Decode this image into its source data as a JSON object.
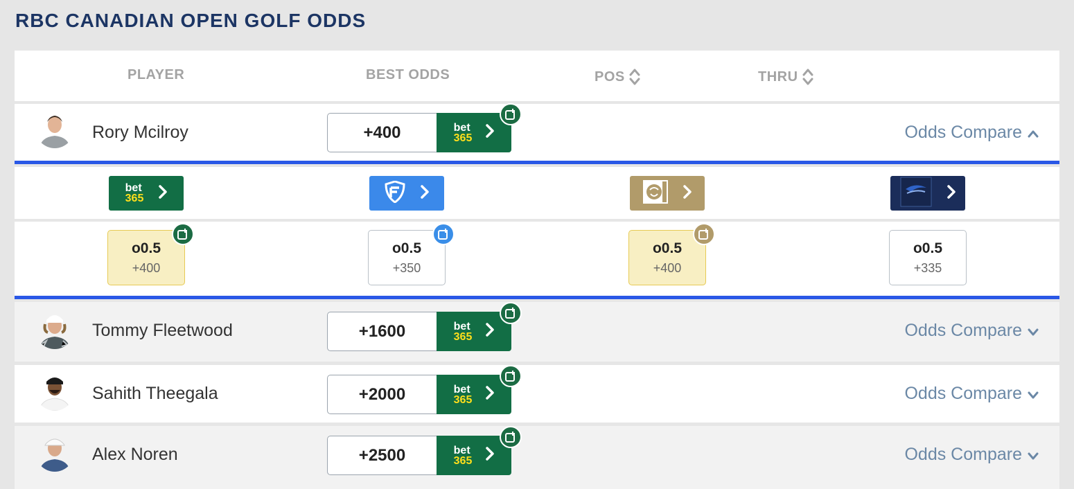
{
  "page": {
    "title": "RBC CANADIAN OPEN GOLF ODDS"
  },
  "colors": {
    "title": "#1c3564",
    "bet365": "#126e45",
    "fanduel": "#3b89ea",
    "betmgm": "#b19b6a",
    "betrivers": "#1b2d5a",
    "expanded_rule": "#2a58e6",
    "link": "#6b88a6"
  },
  "table": {
    "headers": {
      "player": "PLAYER",
      "best_odds": "BEST ODDS",
      "pos": "POS",
      "thru": "THRU"
    }
  },
  "players": [
    {
      "name": "Rory Mcilroy",
      "best_odds": "+400",
      "book_logo": {
        "top": "bet",
        "bottom": "365"
      },
      "compare_label": "Odds Compare",
      "expanded": true
    },
    {
      "name": "Tommy Fleetwood",
      "best_odds": "+1600",
      "book_logo": {
        "top": "bet",
        "bottom": "365"
      },
      "compare_label": "Odds Compare",
      "expanded": false
    },
    {
      "name": "Sahith Theegala",
      "best_odds": "+2000",
      "book_logo": {
        "top": "bet",
        "bottom": "365"
      },
      "compare_label": "Odds Compare",
      "expanded": false
    },
    {
      "name": "Alex Noren",
      "best_odds": "+2500",
      "book_logo": {
        "top": "bet",
        "bottom": "365"
      },
      "compare_label": "Odds Compare",
      "expanded": false
    }
  ],
  "expanded_panel": {
    "sportsbooks": [
      {
        "id": "bet365",
        "logo_top": "bet",
        "logo_bottom": "365",
        "icon": "bet365-logo"
      },
      {
        "id": "fanduel",
        "icon": "fanduel-shield-icon"
      },
      {
        "id": "betmgm",
        "icon": "betmgm-lion-icon"
      },
      {
        "id": "betrivers",
        "logo_text": "BETRIVERS",
        "icon": "betrivers-logo"
      }
    ],
    "markets": [
      {
        "line": "o0.5",
        "odds": "+400",
        "highlight": true,
        "badge": "green"
      },
      {
        "line": "o0.5",
        "odds": "+350",
        "highlight": false,
        "badge": "blue"
      },
      {
        "line": "o0.5",
        "odds": "+400",
        "highlight": true,
        "badge": "gold"
      },
      {
        "line": "o0.5",
        "odds": "+335",
        "highlight": false,
        "badge": "none"
      }
    ]
  }
}
